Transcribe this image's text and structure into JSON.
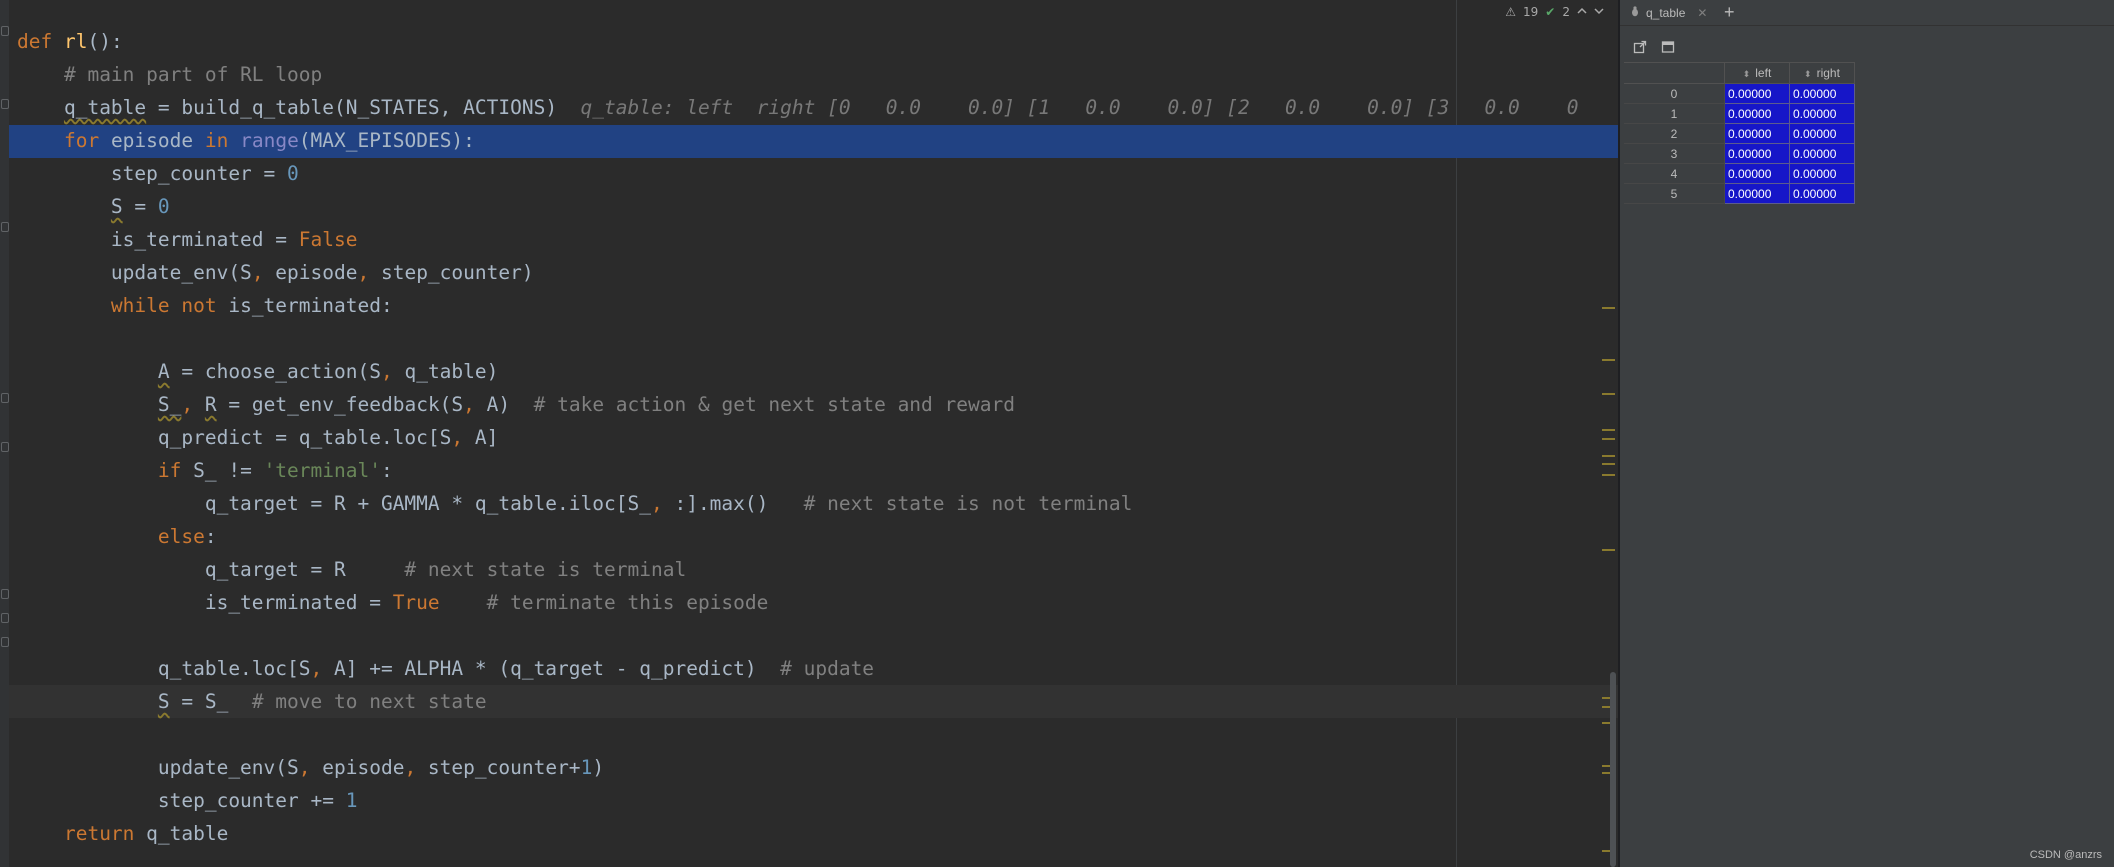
{
  "editor": {
    "inspection": {
      "warnings": "19",
      "passed": "2"
    },
    "inline_hint": "q_table: left  right [0   0.0    0.0] [1   0.0    0.0] [2   0.0    0.0] [3   0.0    0"
  },
  "panel": {
    "tab_label": "q_table",
    "columns": [
      "left",
      "right"
    ],
    "rows": [
      {
        "index": "0",
        "left": "0.00000",
        "right": "0.00000"
      },
      {
        "index": "1",
        "left": "0.00000",
        "right": "0.00000"
      },
      {
        "index": "2",
        "left": "0.00000",
        "right": "0.00000"
      },
      {
        "index": "3",
        "left": "0.00000",
        "right": "0.00000"
      },
      {
        "index": "4",
        "left": "0.00000",
        "right": "0.00000"
      },
      {
        "index": "5",
        "left": "0.00000",
        "right": "0.00000"
      }
    ]
  },
  "watermark": "CSDN @anzrs",
  "colors": {
    "editor_bg": "#2b2b2b",
    "keyword": "#cc7832",
    "builtin": "#8888c6",
    "number": "#6897bb",
    "string": "#6a8759",
    "comment": "#808080",
    "function_name": "#ffc66d",
    "selected_line": "#214283",
    "cell_bg": "#1616c8"
  },
  "icons": [
    "warning-icon",
    "check-icon",
    "chevron-up-icon",
    "chevron-down-icon",
    "bug-icon",
    "close-icon",
    "plus-icon",
    "open-external-icon",
    "window-icon"
  ]
}
